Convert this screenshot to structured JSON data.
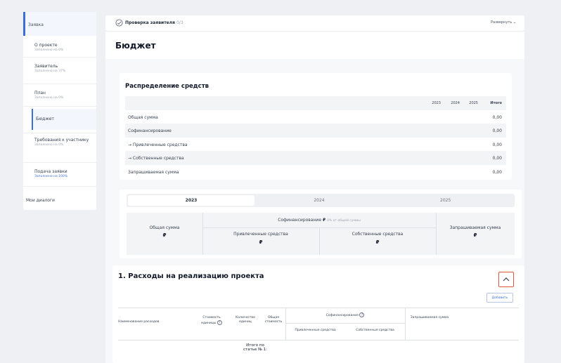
{
  "sidebar": {
    "header": "Заявка",
    "items": [
      {
        "label": "О проекте",
        "status": "Заполнено на 0%"
      },
      {
        "label": "Заявитель",
        "status": "Заполнено на 37%"
      },
      {
        "label": "План",
        "status": "Заполнено на 0%"
      },
      {
        "label": "Бюджет",
        "status": ""
      },
      {
        "label": "Требования к участнику",
        "status": "Заполнено на 0%"
      },
      {
        "label": "Подача заявки",
        "status": "Заполнено на 100%"
      }
    ],
    "dialogs": "Мои диалоги"
  },
  "topbar": {
    "title": "Проверка заявителя",
    "progress": "0/3",
    "expand_label": "Развернуть"
  },
  "page": {
    "title": "Бюджет"
  },
  "distribution": {
    "title": "Распределение средств",
    "years": [
      "2023",
      "2024",
      "2025"
    ],
    "total_label": "Итого",
    "rows": [
      {
        "label": "Общая сумма",
        "value": "0,00"
      },
      {
        "label": "Софинансирование",
        "value": "0,00"
      },
      {
        "label": "→ Привлеченные средства",
        "value": "0,00"
      },
      {
        "label": "→ Собственные средства",
        "value": "0,00"
      },
      {
        "label": "Запрашиваемая сумма",
        "value": "0,00"
      }
    ]
  },
  "year_tabs": [
    "2023",
    "2024",
    "2025"
  ],
  "summary": {
    "total_label": "Общая сумма",
    "cofin_label": "Софинансирование",
    "cofin_note": "0% от общей суммы",
    "attracted_label": "Привлеченные средства",
    "own_label": "Собственные средства",
    "requested_label": "Запрашиваемая сумма",
    "currency": "₽"
  },
  "expenses": {
    "title": "1. Расходы на реализацию проекта",
    "add_label": "Добавить",
    "headers": {
      "name": "Наименование расходов",
      "unit_cost": "Стоимость единицы",
      "quantity": "Количество единиц",
      "total_cost": "Общая стоимость",
      "cofin": "Софинансирование",
      "attracted": "Привлеченные средства",
      "own": "Собственные средства",
      "requested": "Запрашиваемая сумма"
    },
    "subtotal": "Итого по статье № 1:"
  }
}
